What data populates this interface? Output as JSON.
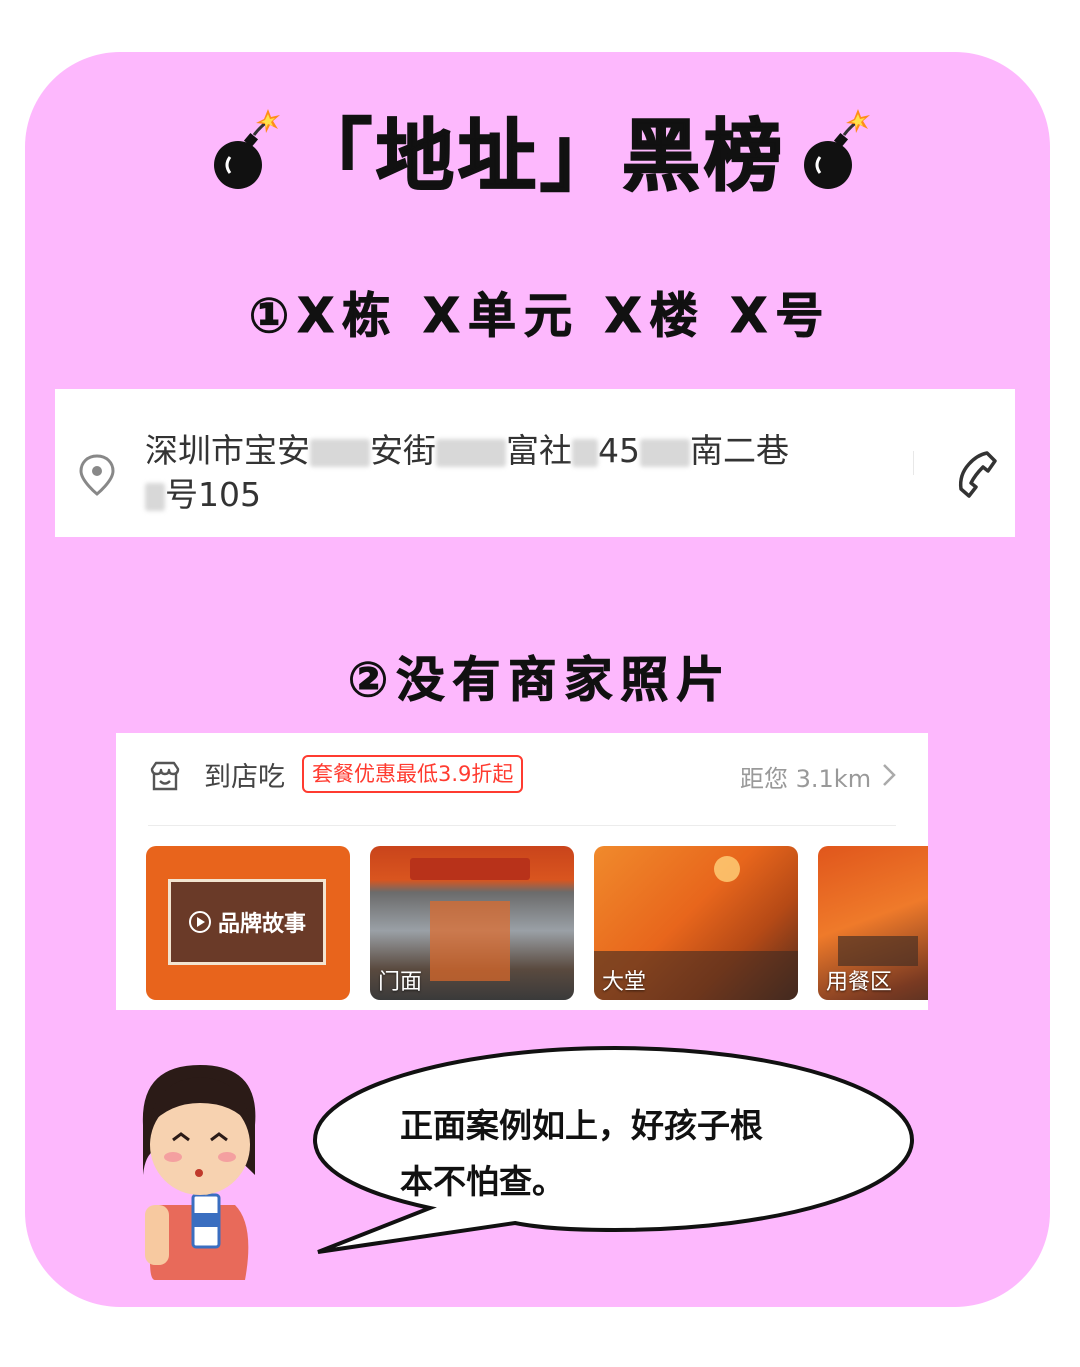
{
  "title": {
    "text": "「地址」黑榜"
  },
  "section1": {
    "heading": "①X栋 X单元 X楼 X号"
  },
  "address": {
    "part1": "深圳市宝安",
    "part2": "安街",
    "part3": "富社",
    "part4": "45",
    "part5": "南二巷",
    "part6": "号105"
  },
  "section2": {
    "heading": "②没有商家照片"
  },
  "shop": {
    "label": "到店吃",
    "promo": "套餐优惠最低3.9折起",
    "distance": "距您 3.1km",
    "photos": [
      {
        "caption": "品牌故事"
      },
      {
        "caption": "门面"
      },
      {
        "caption": "大堂"
      },
      {
        "caption": "用餐区"
      }
    ]
  },
  "speech": {
    "line1": "正面案例如上，好孩子根",
    "line2": "本不怕查。"
  },
  "colors": {
    "card_bg": "#fdb8fd",
    "promo_red": "#ff3b30",
    "photo_orange": "#e8641c"
  },
  "icons": [
    "bomb-icon",
    "location-pin-icon",
    "phone-icon",
    "shop-icon",
    "chevron-right-icon",
    "play-icon"
  ]
}
